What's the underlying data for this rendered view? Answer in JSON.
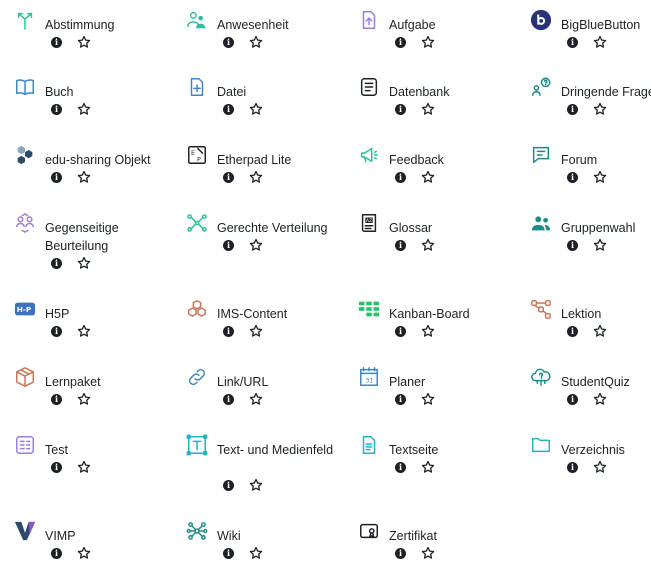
{
  "activities": [
    {
      "label": "Abstimmung",
      "icon": "choice-icon",
      "color": "#2bbf9c"
    },
    {
      "label": "Anwesenheit",
      "icon": "attendance-icon",
      "color": "#2bbf9c"
    },
    {
      "label": "Aufgabe",
      "icon": "assignment-icon",
      "color": "#9b7de0"
    },
    {
      "label": "BigBlueButton",
      "icon": "bigbluebutton-icon",
      "color": "#283274"
    },
    {
      "label": "Buch",
      "icon": "book-icon",
      "color": "#3e86c1"
    },
    {
      "label": "Datei",
      "icon": "file-icon",
      "color": "#3e86c1"
    },
    {
      "label": "Datenbank",
      "icon": "database-icon",
      "color": "#1d2125"
    },
    {
      "label": "Dringende Frage",
      "icon": "urgent-question-icon",
      "color": "#1d8a8a"
    },
    {
      "label": "edu-sharing Objekt",
      "icon": "edu-sharing-icon",
      "color": "#2c4a6b"
    },
    {
      "label": "Etherpad Lite",
      "icon": "etherpad-icon",
      "color": "#1d2125"
    },
    {
      "label": "Feedback",
      "icon": "feedback-icon",
      "color": "#2bbf9c"
    },
    {
      "label": "Forum",
      "icon": "forum-icon",
      "color": "#1d8a8a"
    },
    {
      "label": "Gegenseitige Beurteilung",
      "icon": "workshop-icon",
      "color": "#9b7de0"
    },
    {
      "label": "Gerechte Verteilung",
      "icon": "ratingallocate-icon",
      "color": "#2bbf9c"
    },
    {
      "label": "Glossar",
      "icon": "glossary-icon",
      "color": "#1d2125"
    },
    {
      "label": "Gruppenwahl",
      "icon": "group-choice-icon",
      "color": "#1d8a8a"
    },
    {
      "label": "H5P",
      "icon": "h5p-icon",
      "color": "#3e72c1"
    },
    {
      "label": "IMS-Content",
      "icon": "ims-content-icon",
      "color": "#c7775b"
    },
    {
      "label": "Kanban-Board",
      "icon": "kanban-icon",
      "color": "#2bbf6a"
    },
    {
      "label": "Lektion",
      "icon": "lesson-icon",
      "color": "#c7775b"
    },
    {
      "label": "Lernpaket",
      "icon": "scorm-icon",
      "color": "#c7775b"
    },
    {
      "label": "Link/URL",
      "icon": "link-icon",
      "color": "#3e86c1"
    },
    {
      "label": "Planer",
      "icon": "planner-icon",
      "color": "#3e86c1"
    },
    {
      "label": "StudentQuiz",
      "icon": "studentquiz-icon",
      "color": "#1d8a8a"
    },
    {
      "label": "Test",
      "icon": "quiz-icon",
      "color": "#9b7de0"
    },
    {
      "label": "Text- und Medienfeld",
      "icon": "text-media-icon",
      "color": "#1fb3c4"
    },
    {
      "label": "Textseite",
      "icon": "page-icon",
      "color": "#1fb3c4"
    },
    {
      "label": "Verzeichnis",
      "icon": "folder-icon",
      "color": "#1fb3c4"
    },
    {
      "label": "VIMP",
      "icon": "vimp-icon",
      "color": "#5a2e8a"
    },
    {
      "label": "Wiki",
      "icon": "wiki-icon",
      "color": "#1d8a8a"
    },
    {
      "label": "Zertifikat",
      "icon": "certificate-icon",
      "color": "#1d2125"
    }
  ],
  "info_symbol": "i"
}
